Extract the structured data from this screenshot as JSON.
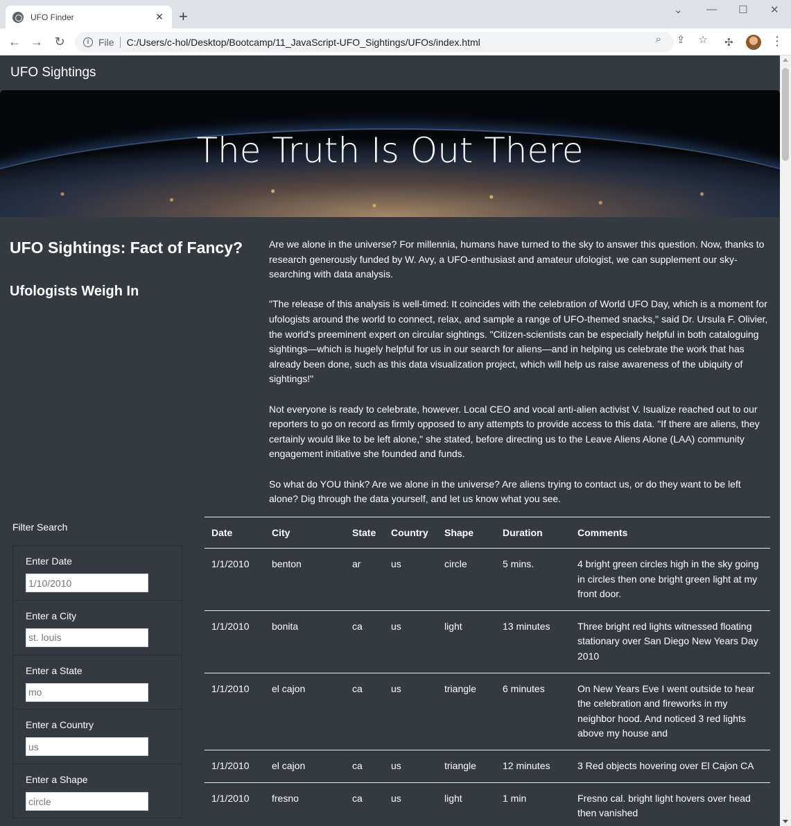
{
  "browser": {
    "tab_title": "UFO Finder",
    "tab_close": "✕",
    "new_tab": "+",
    "scheme": "File",
    "url": "C:/Users/c-hol/Desktop/Bootcamp/11_JavaScript-UFO_Sightings/UFOs/index.html"
  },
  "navbar": {
    "brand": "UFO Sightings"
  },
  "hero": {
    "heading": "The Truth Is Out There"
  },
  "sidebar": {
    "title": "UFO Sightings: Fact of Fancy?",
    "subtitle": "Ufologists Weigh In"
  },
  "article": {
    "paragraphs": [
      "Are we alone in the universe? For millennia, humans have turned to the sky to answer this question. Now, thanks to research generously funded by W. Avy, a UFO-enthusiast and amateur ufologist, we can supplement our sky-searching with data analysis.",
      "\"The release of this analysis is well-timed: It coincides with the celebration of World UFO Day, which is a moment for ufologists around the world to connect, relax, and sample a range of UFO-themed snacks,\" said Dr. Ursula F. Olivier, the world's preeminent expert on circular sightings. \"Citizen-scientists can be especially helpful in both cataloguing sightings—which is hugely helpful for us in our search for aliens—and in helping us celebrate the work that has already been done, such as this data visualization project, which will help us raise awareness of the ubiquity of sightings!\"",
      "Not everyone is ready to celebrate, however. Local CEO and vocal anti-alien activist V. Isualize reached out to our reporters to go on record as firmly opposed to any attempts to provide access to this data. \"If there are aliens, they certainly would like to be left alone,\" she stated, before directing us to the Leave Aliens Alone (LAA) community engagement initiative she founded and funds.",
      "So what do YOU think? Are we alone in the universe? Are aliens trying to contact us, or do they want to be left alone? Dig through the data yourself, and let us know what you see."
    ]
  },
  "filter": {
    "heading": "Filter Search",
    "fields": [
      {
        "label": "Enter Date",
        "placeholder": "1/10/2010"
      },
      {
        "label": "Enter a City",
        "placeholder": "st. louis"
      },
      {
        "label": "Enter a State",
        "placeholder": "mo"
      },
      {
        "label": "Enter a Country",
        "placeholder": "us"
      },
      {
        "label": "Enter a Shape",
        "placeholder": "circle"
      }
    ]
  },
  "table": {
    "headers": [
      "Date",
      "City",
      "State",
      "Country",
      "Shape",
      "Duration",
      "Comments"
    ],
    "rows": [
      [
        "1/1/2010",
        "benton",
        "ar",
        "us",
        "circle",
        "5 mins.",
        "4 bright green circles high in the sky going in circles then one bright green light at my front door."
      ],
      [
        "1/1/2010",
        "bonita",
        "ca",
        "us",
        "light",
        "13 minutes",
        "Three bright red lights witnessed floating stationary over San Diego New Years Day 2010"
      ],
      [
        "1/1/2010",
        "el cajon",
        "ca",
        "us",
        "triangle",
        "6 minutes",
        "On New Years Eve I went outside to hear the celebration and fireworks in my neighbor hood. And noticed 3 red lights above my house and"
      ],
      [
        "1/1/2010",
        "el cajon",
        "ca",
        "us",
        "triangle",
        "12 minutes",
        "3 Red objects hovering over El Cajon CA"
      ],
      [
        "1/1/2010",
        "fresno",
        "ca",
        "us",
        "light",
        "1 min",
        "Fresno cal. bright light hovers over head then vanished"
      ]
    ]
  }
}
